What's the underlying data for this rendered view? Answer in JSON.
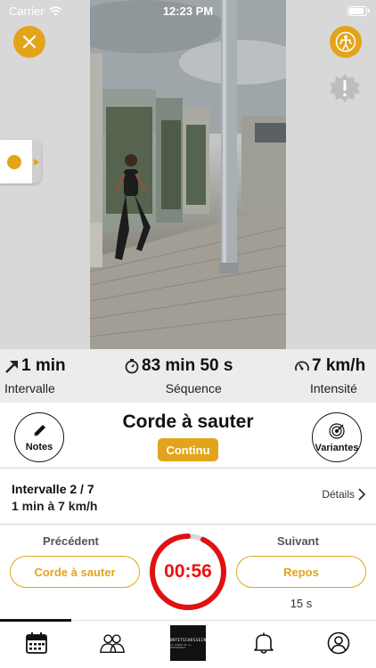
{
  "status_bar": {
    "carrier": "Carrier",
    "time": "12:23 PM"
  },
  "stats": [
    {
      "icon": "arrow-up-right-icon",
      "value": "1 min",
      "label": "Intervalle"
    },
    {
      "icon": "stopwatch-icon",
      "value": "83 min 50 s",
      "label": "Séquence"
    },
    {
      "icon": "gauge-icon",
      "value": "7 km/h",
      "label": "Intensité"
    }
  ],
  "exercise": {
    "title": "Corde à sauter",
    "badge": "Continu",
    "notes_label": "Notes",
    "variants_label": "Variantes"
  },
  "interval": {
    "title": "Intervalle 2 / 7",
    "subtitle": "1 min à 7 km/h",
    "details_label": "Détails"
  },
  "navigation": {
    "previous_label": "Précédent",
    "previous_exercise": "Corde à sauter",
    "timer": "00:56",
    "timer_progress_remaining": 0.93,
    "next_label": "Suivant",
    "next_exercise": "Repos",
    "next_duration": "15 s"
  },
  "tabbar": {
    "tabs": [
      "calendar-icon",
      "group-icon",
      "app-logo",
      "bell-icon",
      "profile-icon"
    ],
    "logo_text": "MONTETSCHOSSEING",
    "logo_sub": "LA COURSE DE LA PERFORMANCE"
  },
  "colors": {
    "accent": "#e3a41a",
    "timer": "#e11111",
    "stats_bg": "#ececec"
  }
}
